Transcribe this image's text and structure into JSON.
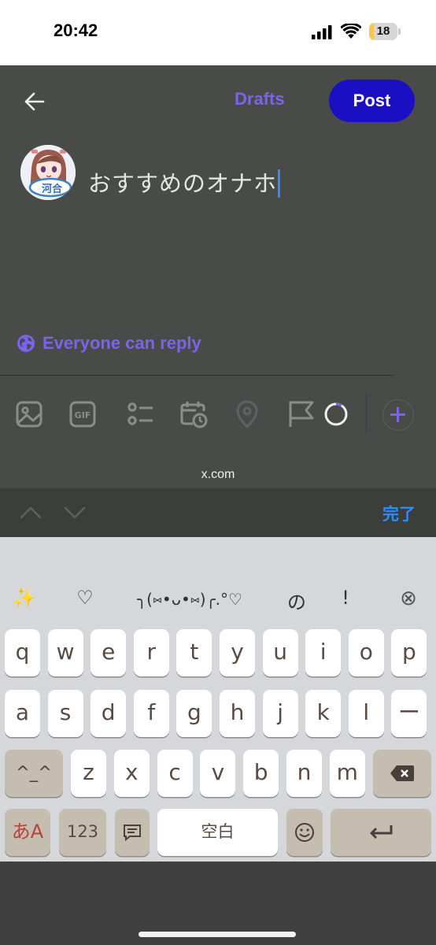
{
  "status_bar": {
    "time": "20:42",
    "battery_level": "18",
    "battery_fraction": 0.18
  },
  "composer": {
    "drafts_label": "Drafts",
    "post_label": "Post",
    "text": "おすすめのオナホ",
    "reply_setting": "Everyone can reply",
    "avatar_badge": "河合",
    "toolbar_icons": [
      "image-icon",
      "gif-icon",
      "poll-icon",
      "schedule-icon",
      "location-icon",
      "flag-icon",
      "character-count-ring",
      "add-icon"
    ],
    "gif_label": "GIF"
  },
  "browser": {
    "url": "x.com"
  },
  "accessory_bar": {
    "done_label": "完了"
  },
  "keyboard": {
    "suggestions": [
      "✨",
      "♡",
      "╮(⑅•ᴗ•⑅)╭.°♡",
      "の",
      "!",
      "⊗"
    ],
    "row1": [
      "q",
      "w",
      "e",
      "r",
      "t",
      "y",
      "u",
      "i",
      "o",
      "p"
    ],
    "row2": [
      "a",
      "s",
      "d",
      "f",
      "g",
      "h",
      "j",
      "k",
      "l",
      "ー"
    ],
    "row3": [
      "z",
      "x",
      "c",
      "v",
      "b",
      "n",
      "m"
    ],
    "shift_label": "^_^",
    "kana_label": "あA",
    "numbers_label": "123",
    "space_label": "空白",
    "colors": {
      "accent": "#7b63ea",
      "post": "#1b0fc4",
      "done": "#2e8ef7"
    }
  }
}
